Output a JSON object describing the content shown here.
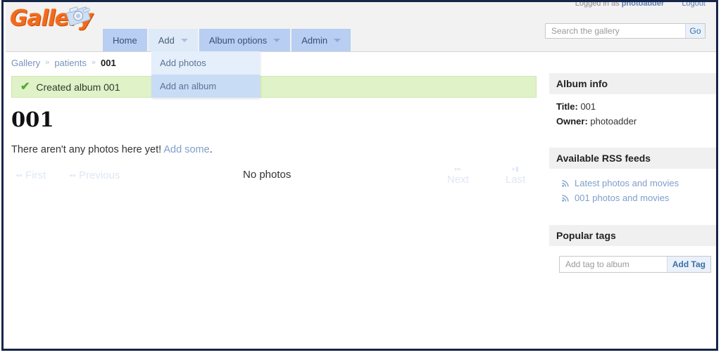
{
  "brand": {
    "logo_text": "Gallery",
    "logo_color": "#f26b1d"
  },
  "user_bar": {
    "logged_in_prefix": "Logged in as",
    "username": "photoadder",
    "logout_label": "Logout"
  },
  "search": {
    "placeholder": "Search the gallery",
    "value": "",
    "go_label": "Go"
  },
  "nav": {
    "tabs": [
      {
        "label": "Home",
        "has_caret": false,
        "active": false
      },
      {
        "label": "Add",
        "has_caret": true,
        "active": true
      },
      {
        "label": "Album options",
        "has_caret": true,
        "active": false
      },
      {
        "label": "Admin",
        "has_caret": true,
        "active": false
      }
    ],
    "dropdown": {
      "open_for": "Add",
      "items": [
        {
          "label": "Add photos",
          "hover": false
        },
        {
          "label": "Add an album",
          "hover": true
        }
      ]
    }
  },
  "breadcrumb": {
    "items": [
      {
        "label": "Gallery",
        "current": false
      },
      {
        "label": "patients",
        "current": false
      },
      {
        "label": "001",
        "current": true
      }
    ],
    "separator": "»"
  },
  "message": {
    "icon": "check-icon",
    "text": "Created album 001",
    "background": "#dff2c8",
    "icon_color": "#59a832"
  },
  "album": {
    "title": "001",
    "empty_text": "There aren't any photos here yet!",
    "empty_link": "Add some",
    "empty_suffix": "."
  },
  "pager": {
    "first": {
      "label": "First",
      "icon": "◂◂"
    },
    "previous": {
      "label": "Previous",
      "icon": "◂◂"
    },
    "status": "No photos",
    "next": {
      "label": "Next",
      "icon": "▸▸"
    },
    "last": {
      "label": "Last",
      "icon": "▸▮"
    }
  },
  "sidebar": {
    "album_info": {
      "heading": "Album info",
      "title_label": "Title:",
      "title_value": "001",
      "owner_label": "Owner:",
      "owner_value": "photoadder"
    },
    "rss": {
      "heading": "Available RSS feeds",
      "feeds": [
        {
          "label": "Latest photos and movies"
        },
        {
          "label": "001 photos and movies"
        }
      ]
    },
    "tags": {
      "heading": "Popular tags",
      "input_placeholder": "Add tag to album",
      "input_value": "",
      "submit_label": "Add Tag"
    }
  }
}
